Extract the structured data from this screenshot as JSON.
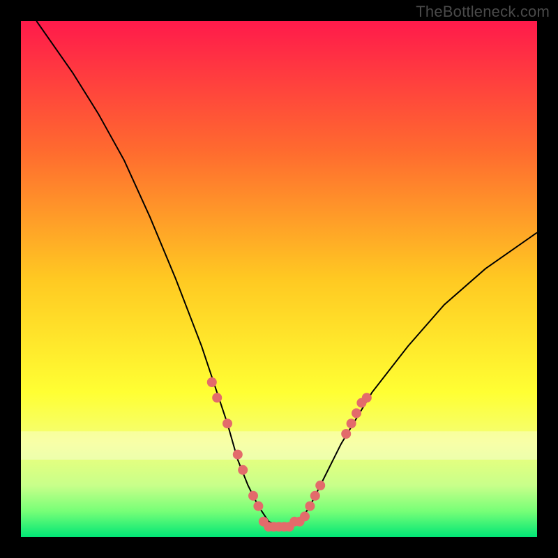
{
  "watermark": "TheBottleneck.com",
  "chart_data": {
    "type": "line",
    "title": "",
    "xlabel": "",
    "ylabel": "",
    "xlim": [
      0,
      100
    ],
    "ylim": [
      0,
      100
    ],
    "grid": false,
    "legend": false,
    "background_gradient": {
      "stops": [
        {
          "offset": 0.0,
          "color": "#ff1a4b"
        },
        {
          "offset": 0.25,
          "color": "#ff6a2f"
        },
        {
          "offset": 0.5,
          "color": "#ffc922"
        },
        {
          "offset": 0.72,
          "color": "#ffff33"
        },
        {
          "offset": 0.82,
          "color": "#f3ff7a"
        },
        {
          "offset": 0.9,
          "color": "#c8ff8a"
        },
        {
          "offset": 0.95,
          "color": "#77ff77"
        },
        {
          "offset": 1.0,
          "color": "#00e676"
        }
      ]
    },
    "series": [
      {
        "name": "bottleneck-curve",
        "color": "#000000",
        "stroke_width": 2,
        "x": [
          3,
          10,
          15,
          20,
          25,
          30,
          35,
          38,
          40,
          42,
          44,
          46,
          48,
          50,
          52,
          54,
          56,
          58,
          62,
          68,
          75,
          82,
          90,
          100
        ],
        "y": [
          100,
          90,
          82,
          73,
          62,
          50,
          37,
          28,
          22,
          15,
          10,
          6,
          3,
          2,
          2,
          3,
          6,
          10,
          18,
          28,
          37,
          45,
          52,
          59
        ]
      }
    ],
    "marker_clusters": [
      {
        "name": "left-cluster",
        "color": "#e36b6b",
        "radius": 7,
        "points": [
          {
            "x": 37,
            "y": 30
          },
          {
            "x": 38,
            "y": 27
          },
          {
            "x": 40,
            "y": 22
          },
          {
            "x": 42,
            "y": 16
          },
          {
            "x": 43,
            "y": 13
          },
          {
            "x": 45,
            "y": 8
          },
          {
            "x": 46,
            "y": 6
          }
        ]
      },
      {
        "name": "bottom-cluster",
        "color": "#e36b6b",
        "radius": 7,
        "points": [
          {
            "x": 47,
            "y": 3
          },
          {
            "x": 48,
            "y": 2
          },
          {
            "x": 49,
            "y": 2
          },
          {
            "x": 50,
            "y": 2
          },
          {
            "x": 51,
            "y": 2
          },
          {
            "x": 52,
            "y": 2
          },
          {
            "x": 53,
            "y": 3
          },
          {
            "x": 54,
            "y": 3
          },
          {
            "x": 55,
            "y": 4
          }
        ]
      },
      {
        "name": "right-cluster",
        "color": "#e36b6b",
        "radius": 7,
        "points": [
          {
            "x": 56,
            "y": 6
          },
          {
            "x": 57,
            "y": 8
          },
          {
            "x": 58,
            "y": 10
          },
          {
            "x": 63,
            "y": 20
          },
          {
            "x": 64,
            "y": 22
          },
          {
            "x": 65,
            "y": 24
          },
          {
            "x": 66,
            "y": 26
          },
          {
            "x": 67,
            "y": 27
          }
        ]
      }
    ]
  }
}
